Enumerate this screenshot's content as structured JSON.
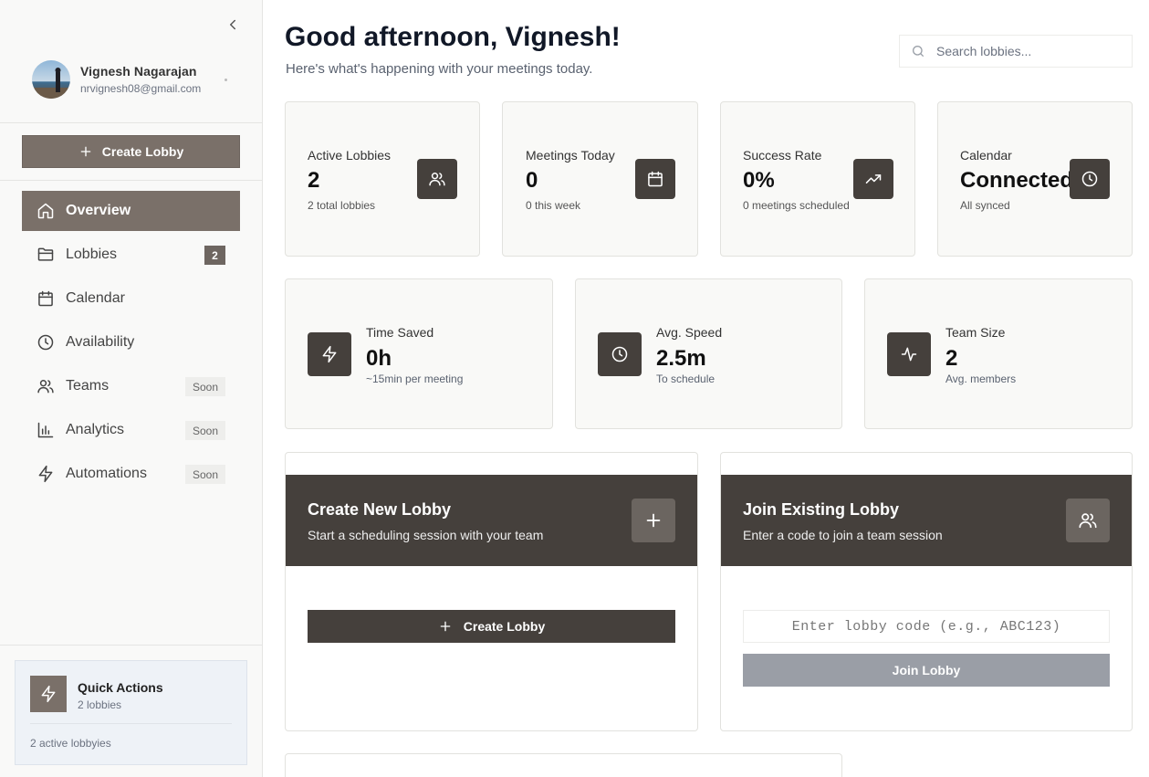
{
  "sidebar": {
    "collapse_icon": "chevron-left-icon",
    "profile": {
      "name": "Vignesh Nagarajan",
      "email": "nrvignesh08@gmail.com"
    },
    "create_label": "Create Lobby",
    "nav": [
      {
        "label": "Overview",
        "icon": "home-icon",
        "active": true
      },
      {
        "label": "Lobbies",
        "icon": "folder-icon",
        "badge": "2"
      },
      {
        "label": "Calendar",
        "icon": "calendar-icon"
      },
      {
        "label": "Availability",
        "icon": "clock-icon"
      },
      {
        "label": "Teams",
        "icon": "users-icon",
        "tag": "Soon"
      },
      {
        "label": "Analytics",
        "icon": "bar-chart-icon",
        "tag": "Soon"
      },
      {
        "label": "Automations",
        "icon": "zap-icon",
        "tag": "Soon"
      }
    ],
    "quick_actions": {
      "title": "Quick Actions",
      "subtitle": "2 lobbies",
      "footer": "2 active lobbyies"
    }
  },
  "header": {
    "greeting": "Good afternoon, Vignesh!",
    "subtitle": "Here's what's happening with your meetings today.",
    "search_placeholder": "Search lobbies..."
  },
  "stats_row1": [
    {
      "label": "Active Lobbies",
      "value": "2",
      "sub": "2 total lobbies",
      "icon": "users-icon"
    },
    {
      "label": "Meetings Today",
      "value": "0",
      "sub": "0 this week",
      "icon": "calendar-icon"
    },
    {
      "label": "Success Rate",
      "value": "0%",
      "sub": "0 meetings scheduled",
      "icon": "trending-up-icon"
    },
    {
      "label": "Calendar",
      "value": "Connected",
      "sub": "All synced",
      "icon": "clock-icon"
    }
  ],
  "stats_row2": [
    {
      "label": "Time Saved",
      "value": "0h",
      "sub": "~15min per meeting",
      "icon": "zap-icon"
    },
    {
      "label": "Avg. Speed",
      "value": "2.5m",
      "sub": "To schedule",
      "icon": "clock-icon"
    },
    {
      "label": "Team Size",
      "value": "2",
      "sub": "Avg. members",
      "icon": "activity-icon"
    }
  ],
  "create_card": {
    "title": "Create New Lobby",
    "subtitle": "Start a scheduling session with your team",
    "button": "Create Lobby"
  },
  "join_card": {
    "title": "Join Existing Lobby",
    "subtitle": "Enter a code to join a team session",
    "placeholder": "Enter lobby code (e.g., ABC123)",
    "button": "Join Lobby"
  },
  "colors": {
    "accent": "#7a7069",
    "dark": "#45403c",
    "disabled": "#9a9ea6"
  }
}
